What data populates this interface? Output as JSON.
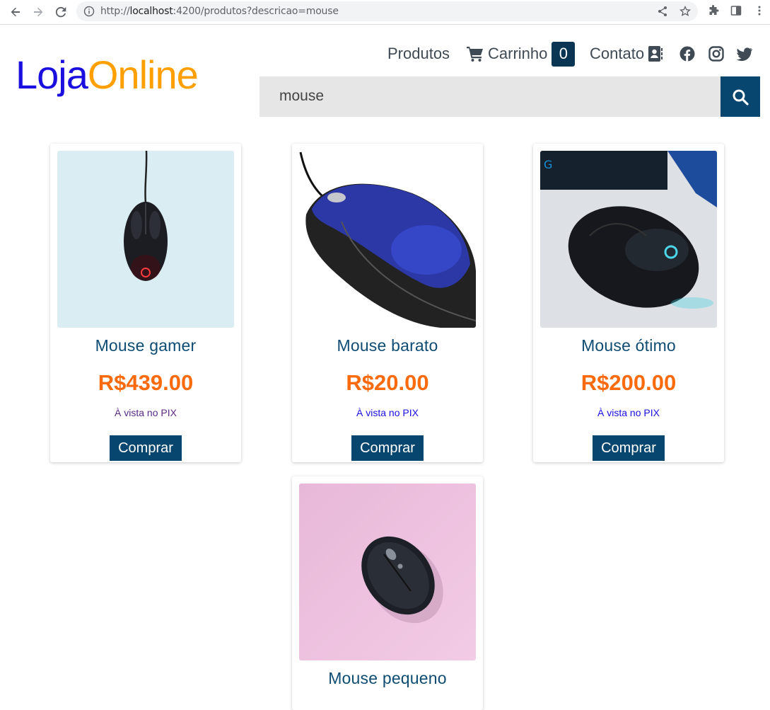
{
  "browser": {
    "url_prefix": "http://",
    "url_host": "localhost",
    "url_rest": ":4200/produtos?descricao=mouse"
  },
  "header": {
    "logo_part1": "Loja",
    "logo_part2": "Online",
    "nav": {
      "produtos": "Produtos",
      "carrinho": "Carrinho",
      "cart_count": "0",
      "contato": "Contato"
    },
    "social_icons": [
      "facebook-icon",
      "instagram-icon",
      "twitter-icon"
    ],
    "search_value": "mouse"
  },
  "products": [
    {
      "title": "Mouse gamer",
      "price": "R$439.00",
      "payment": "À vista no PIX",
      "payment_color": "#5b2a86",
      "buy": "Comprar"
    },
    {
      "title": "Mouse barato",
      "price": "R$20.00",
      "payment": "À vista no PIX",
      "payment_color": "#1a0fdf",
      "buy": "Comprar"
    },
    {
      "title": "Mouse ótimo",
      "price": "R$200.00",
      "payment": "À vista no PIX",
      "payment_color": "#1a0fdf",
      "buy": "Comprar"
    },
    {
      "title": "Mouse pequeno"
    }
  ],
  "colors": {
    "primary": "#07466e",
    "price": "#fb6b0e",
    "logo_blue": "#1a0fdf",
    "logo_orange": "#ff9f00"
  }
}
